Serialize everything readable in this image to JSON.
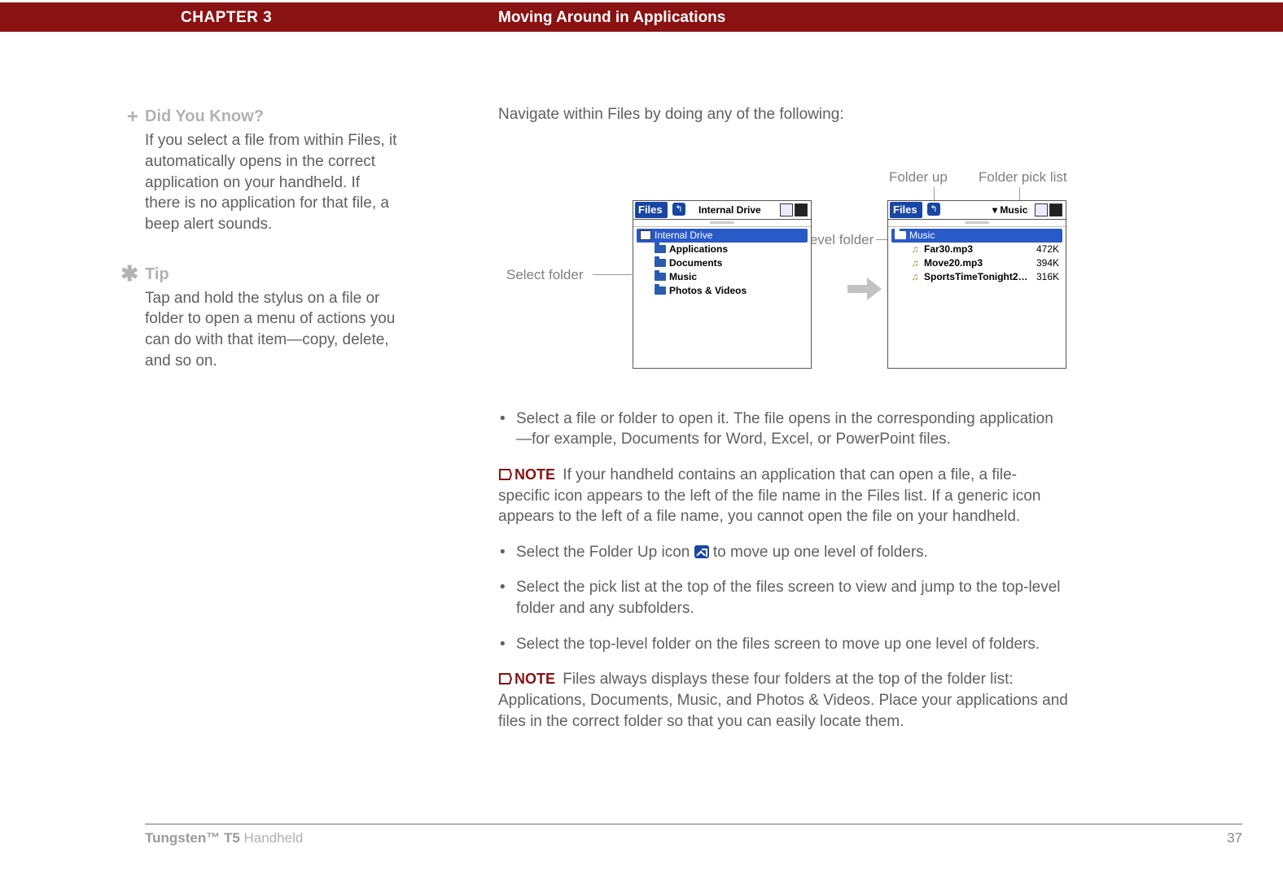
{
  "header": {
    "chapter": "CHAPTER 3",
    "title": "Moving Around in Applications"
  },
  "sidebar": {
    "dyk": {
      "heading": "Did You Know?",
      "body": "If you select a file from within Files, it automatically opens in the correct application on your handheld. If there is no application for that file, a beep alert sounds."
    },
    "tip": {
      "heading": "Tip",
      "body": "Tap and hold the stylus on a file or folder to open a menu of actions you can do with that item—copy, delete, and so on."
    }
  },
  "main": {
    "intro": "Navigate within Files by doing any of the following:",
    "labels": {
      "select_folder": "Select folder",
      "folder_up": "Folder up",
      "folder_pick_list": "Folder pick list",
      "top_level_folder": "Top-level folder"
    },
    "screenshot_left": {
      "app": "Files",
      "drive": "Internal Drive",
      "rows": [
        {
          "type": "drive",
          "label": "Internal Drive"
        },
        {
          "type": "folder",
          "label": "Applications"
        },
        {
          "type": "folder",
          "label": "Documents"
        },
        {
          "type": "folder",
          "label": "Music"
        },
        {
          "type": "folder",
          "label": "Photos & Videos"
        }
      ]
    },
    "screenshot_right": {
      "app": "Files",
      "picklist": "Music",
      "toprow": {
        "label": "Music"
      },
      "files": [
        {
          "name": "Far30.mp3",
          "size": "472K"
        },
        {
          "name": "Move20.mp3",
          "size": "394K"
        },
        {
          "name": "SportsTimeTonight2…",
          "size": "316K"
        }
      ]
    },
    "bullet1": "Select a file or folder to open it. The file opens in the corresponding application—for example, Documents for Word, Excel, or PowerPoint files.",
    "note1_label": "NOTE",
    "note1": "If your handheld contains an application that can open a file, a file-specific icon appears to the left of the file name in the Files list. If a generic icon appears to the left of a file name, you cannot open the file on your handheld.",
    "bullet2a": "Select the Folder Up icon ",
    "bullet2b": " to move up one level of folders.",
    "bullet3": "Select the pick list at the top of the files screen to view and jump to the top-level folder and any subfolders.",
    "bullet4": "Select the top-level folder on the files screen to move up one level of folders.",
    "note2_label": "NOTE",
    "note2": "Files always displays these four folders at the top of the folder list: Applications, Documents, Music, and Photos & Videos. Place your applications and files in the correct folder so that you can easily locate them."
  },
  "footer": {
    "product_bold": "Tungsten™ T5 ",
    "product_light": "Handheld",
    "page": "37"
  }
}
